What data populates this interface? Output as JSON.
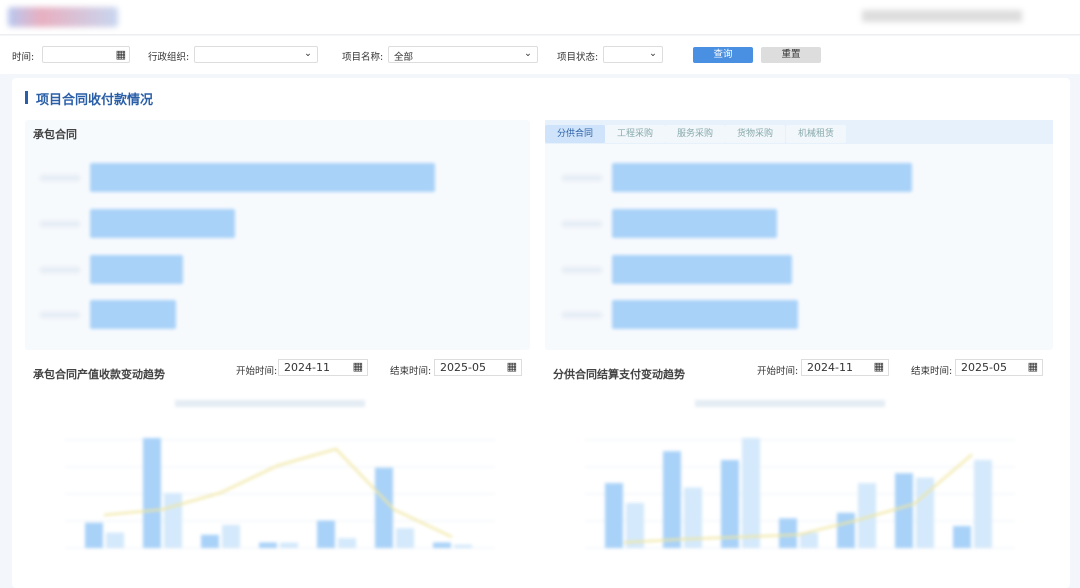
{
  "filters": {
    "time_label": "时间:",
    "org_label": "行政组织:",
    "project_label": "项目名称:",
    "project_value": "全部",
    "status_label": "项目状态:",
    "query_button": "查询",
    "reset_button": "重置"
  },
  "section_title": "项目合同收付款情况",
  "left_panel": {
    "title": "承包合同",
    "bars": [
      1.0,
      0.42,
      0.27,
      0.25
    ]
  },
  "right_panel": {
    "tabs": [
      "分供合同",
      "工程采购",
      "服务采购",
      "货物采购",
      "机械租赁"
    ],
    "active_tab": "分供合同",
    "bars": [
      1.0,
      0.55,
      0.6,
      0.62
    ]
  },
  "trend_left": {
    "title": "承包合同产值收款变动趋势",
    "start_label": "开始时间:",
    "start": "2024-11",
    "end_label": "结束时间:",
    "end": "2025-05",
    "dark": [
      0.23,
      1.0,
      0.12,
      0.05,
      0.25,
      0.73,
      0.05
    ],
    "light": [
      0.14,
      0.5,
      0.21,
      0.05,
      0.09,
      0.18,
      0.03
    ],
    "line": [
      0.3,
      0.35,
      0.5,
      0.75,
      0.9,
      0.35,
      0.1
    ]
  },
  "trend_right": {
    "title": "分供合同结算支付变动趋势",
    "start_label": "开始时间:",
    "start": "2024-11",
    "end_label": "结束时间:",
    "end": "2025-05",
    "dark": [
      0.59,
      0.88,
      0.8,
      0.27,
      0.32,
      0.68,
      0.2
    ],
    "light": [
      0.41,
      0.55,
      1.0,
      0.14,
      0.59,
      0.64,
      0.8
    ],
    "line": [
      0.05,
      0.08,
      0.1,
      0.12,
      0.25,
      0.4,
      0.85
    ]
  },
  "colors": {
    "accent": "#4a90e2",
    "bar": "#a9d2f8",
    "bar_light": "#d4e9fb",
    "line": "#f0e6a0"
  }
}
